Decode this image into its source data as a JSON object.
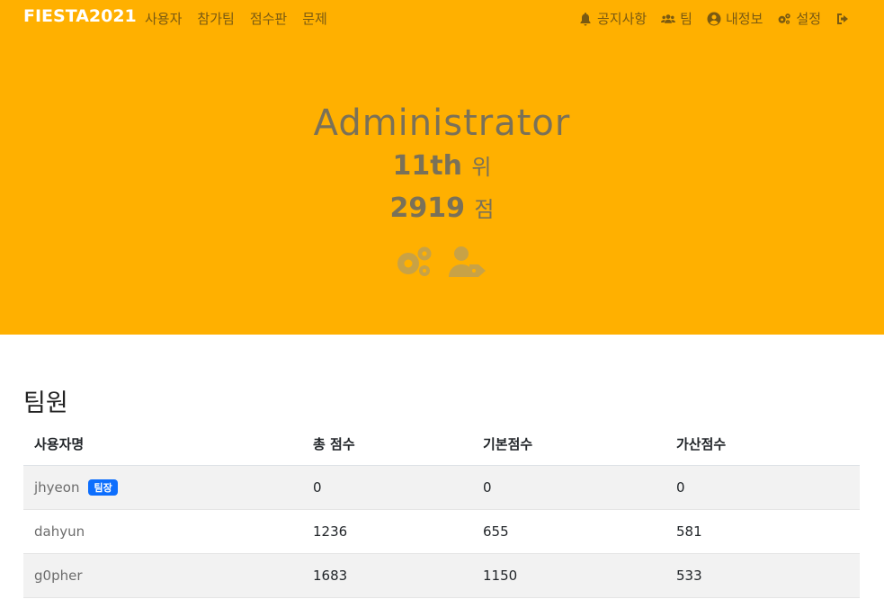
{
  "navbar": {
    "brand": "FIESTA2021",
    "left_items": [
      {
        "label": "사용자"
      },
      {
        "label": "참가팀"
      },
      {
        "label": "점수판"
      },
      {
        "label": "문제"
      }
    ],
    "right_items": [
      {
        "label": "공지사항",
        "icon": "bell-icon"
      },
      {
        "label": "팀",
        "icon": "users-icon"
      },
      {
        "label": "내정보",
        "icon": "user-circle-icon"
      },
      {
        "label": "설정",
        "icon": "gears-icon"
      },
      {
        "label": "",
        "icon": "sign-out-icon"
      }
    ]
  },
  "profile": {
    "name": "Administrator",
    "rank": "11th",
    "rank_unit": "위",
    "score": "2919",
    "score_unit": "점",
    "actions": [
      {
        "icon": "gears-icon"
      },
      {
        "icon": "user-tag-icon"
      }
    ]
  },
  "members": {
    "title": "팀원",
    "columns": [
      "사용자명",
      "총 점수",
      "기본점수",
      "가산점수"
    ],
    "rows": [
      {
        "name": "jhyeon",
        "badge": "팀장",
        "total": "0",
        "base": "0",
        "bonus": "0"
      },
      {
        "name": "dahyun",
        "badge": "",
        "total": "1236",
        "base": "655",
        "bonus": "581"
      },
      {
        "name": "g0pher",
        "badge": "",
        "total": "1683",
        "base": "1150",
        "bonus": "533"
      }
    ]
  },
  "colors": {
    "hero_bg": "#ffb000",
    "nav_text": "#7a5a12",
    "brand_text": "#ffffff",
    "profile_text": "#7a7158",
    "badge_bg": "#0d6efd"
  }
}
